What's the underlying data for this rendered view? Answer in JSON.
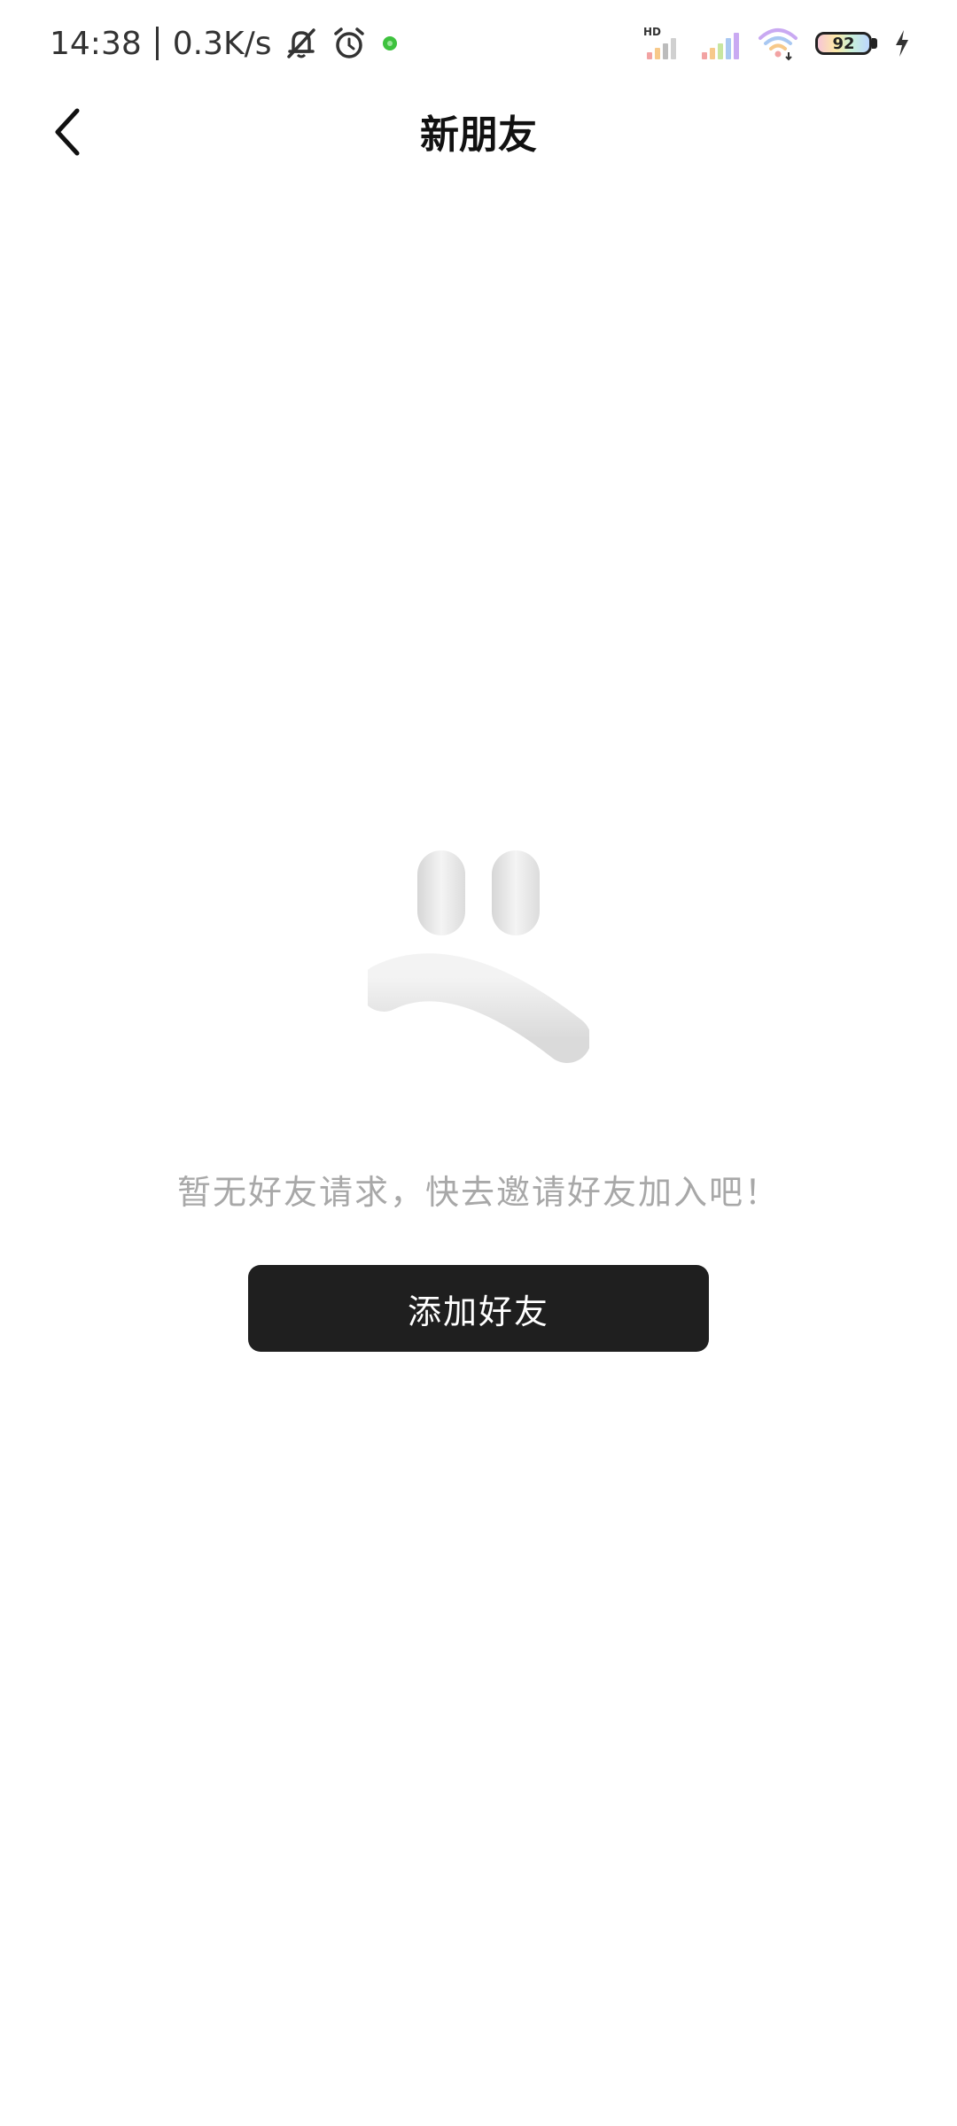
{
  "status_bar": {
    "time": "14:38",
    "net_speed": "0.3K/s",
    "battery_level": "92",
    "hd_label": "HD",
    "icons": [
      "mute-bell-icon",
      "alarm-icon",
      "notification-dot-icon",
      "hd-signal-icon",
      "signal-icon",
      "wifi-icon",
      "battery-icon",
      "charging-icon"
    ]
  },
  "header": {
    "title": "新朋友",
    "back_icon": "chevron-left-icon"
  },
  "empty_state": {
    "message": "暂无好友请求，快去邀请好友加入吧！",
    "button_label": "添加好友",
    "illustration": "sad-face-icon"
  },
  "colors": {
    "button_bg": "#1f1f1f",
    "message_text": "#a8a8a8",
    "notification_dot": "#3ec23e"
  }
}
